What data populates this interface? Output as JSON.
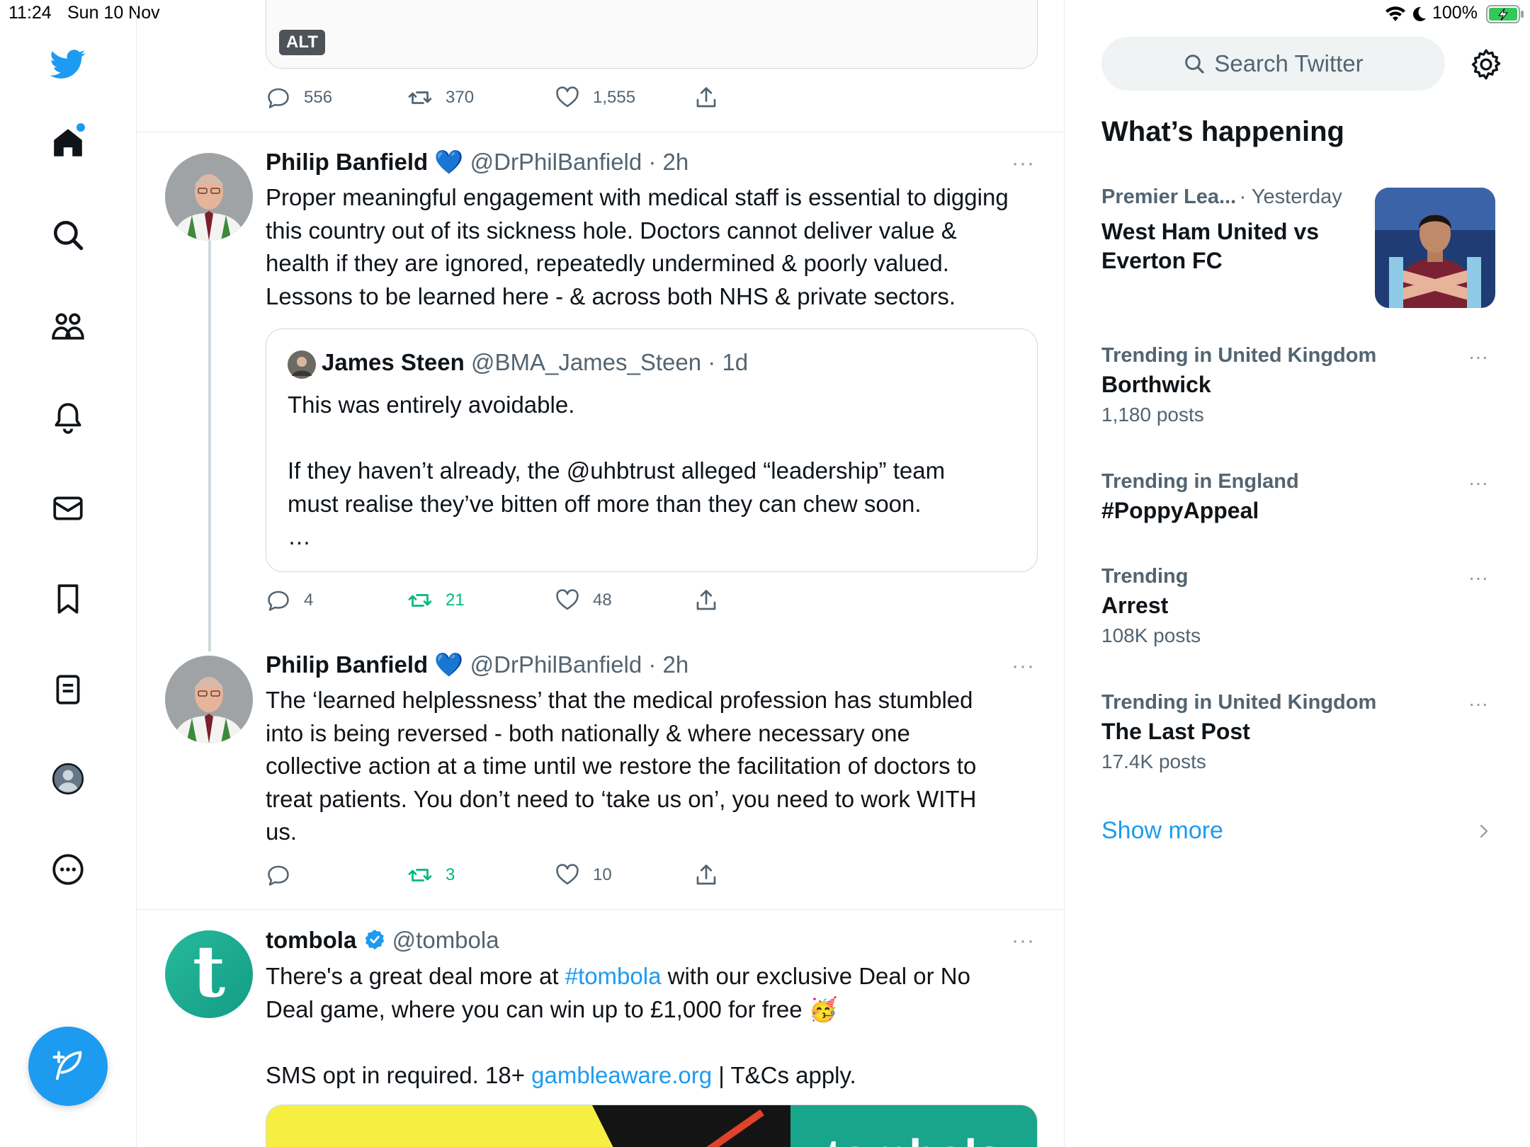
{
  "status_bar": {
    "time": "11:24",
    "date": "Sun 10 Nov",
    "battery": "100%",
    "multitask_dots": "•••"
  },
  "nav": {
    "items": [
      "twitter-logo",
      "home",
      "explore",
      "communities",
      "notifications",
      "messages",
      "bookmarks",
      "lists",
      "profile",
      "more"
    ],
    "brand_color": "#1d9bf0"
  },
  "timeline": {
    "top_tweet": {
      "alt_badge": "ALT",
      "replies": "556",
      "retweets": "370",
      "likes": "1,555"
    },
    "tweet1": {
      "name": "Philip Banfield",
      "badge": "💙",
      "handle": "@DrPhilBanfield · 2h",
      "more": "···",
      "text": "Proper meaningful engagement with medical staff is essential to digging\nthis country out of its sickness hole. Doctors cannot deliver value &\nhealth if they are ignored, repeatedly undermined & poorly valued.\nLessons to be learned here - & across both NHS & private sectors.",
      "quote": {
        "name": "James Steen",
        "handle": "@BMA_James_Steen · 1d",
        "text": "This was entirely avoidable.\n\nIf they haven’t already, the @uhbtrust alleged “leadership” team\nmust realise they’ve bitten off more than they can chew soon.\n…"
      },
      "replies": "4",
      "retweets": "21",
      "likes": "48"
    },
    "tweet2": {
      "name": "Philip Banfield",
      "badge": "💙",
      "handle": "@DrPhilBanfield · 2h",
      "more": "···",
      "text": "The ‘learned helplessness’ that the medical profession has stumbled\ninto is being reversed - both nationally & where necessary one\ncollective action at a time until we restore the facilitation of doctors to\ntreat patients. You don’t need to ‘take us on’, you need to work WITH\nus.",
      "retweets": "3",
      "likes": "10"
    },
    "tweet3": {
      "name": "tombola",
      "handle": "@tombola",
      "more": "···",
      "text_part1": "There's a great deal more at ",
      "hashtag": "#tombola",
      "text_part2": " with our exclusive Deal or No\nDeal game, where you can win up to £1,000 for free 🥳",
      "text_part3": "SMS opt in required. 18+ ",
      "link": "gambleaware.org",
      "text_part4": " | T&Cs apply.",
      "avatar_letter": "t",
      "media_text": "tombola"
    }
  },
  "sidebar": {
    "search_placeholder": "Search Twitter",
    "heading": "What’s happening",
    "featured": {
      "category": "Premier Lea...",
      "time": "· Yesterday",
      "title": "West Ham United vs\nEverton FC"
    },
    "trends": [
      {
        "category": "Trending in United Kingdom",
        "title": "Borthwick",
        "count": "1,180 posts"
      },
      {
        "category": "Trending in England",
        "title": "#PoppyAppeal",
        "count": ""
      },
      {
        "category": "Trending",
        "title": "Arrest",
        "count": "108K posts"
      },
      {
        "category": "Trending in United Kingdom",
        "title": "The Last Post",
        "count": "17.4K posts"
      }
    ],
    "more_dots": "···",
    "show_more": "Show more"
  }
}
